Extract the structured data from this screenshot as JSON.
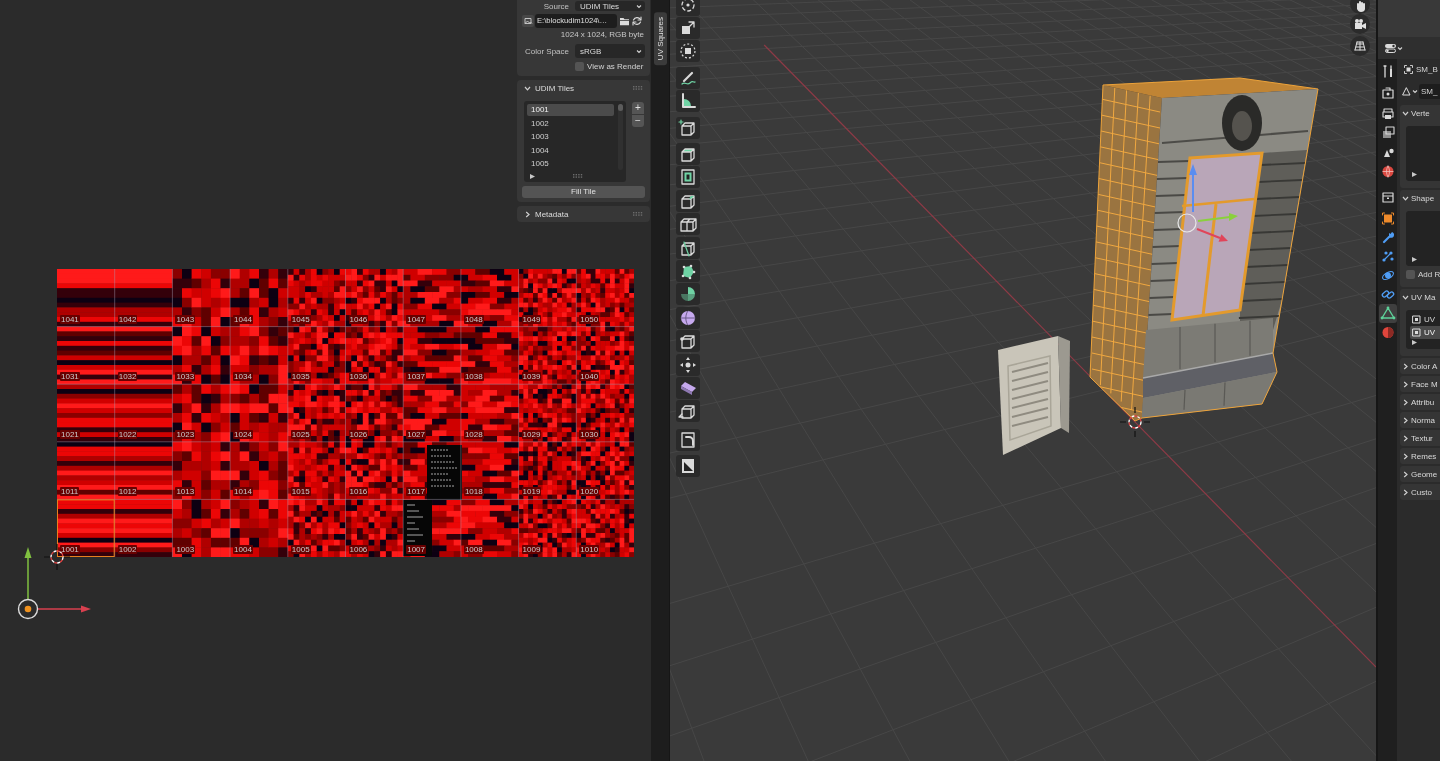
{
  "uv_editor": {
    "sidebar_tabs": [
      {
        "label": "UV Squares",
        "selected": true
      }
    ],
    "image_panel": {
      "source_label": "Source",
      "source_value": "UDIM Tiles",
      "filepath": "E:\\blockudim1024\\…",
      "info": "1024 x 1024, RGB byte",
      "color_space_label": "Color Space",
      "color_space_value": "sRGB",
      "view_as_render": {
        "label": "View as Render",
        "checked": false
      }
    },
    "udim_tiles_panel": {
      "title": "UDIM Tiles",
      "expanded": true,
      "items": [
        {
          "label": "1001",
          "selected": true
        },
        {
          "label": "1002",
          "selected": false
        },
        {
          "label": "1003",
          "selected": false
        },
        {
          "label": "1004",
          "selected": false
        },
        {
          "label": "1005",
          "selected": false
        }
      ],
      "add_button": "+",
      "remove_button": "−",
      "fill_button": "Fill Tile"
    },
    "metadata_panel": {
      "title": "Metadata",
      "expanded": false
    },
    "image_tiles": [
      "1041",
      "1042",
      "1043",
      "1044",
      "1045",
      "1046",
      "1047",
      "1048",
      "1049",
      "1050",
      "1031",
      "1032",
      "1033",
      "1034",
      "1035",
      "1036",
      "1037",
      "1038",
      "1039",
      "1040",
      "1021",
      "1022",
      "1023",
      "1024",
      "1025",
      "1026",
      "1027",
      "1028",
      "1029",
      "1030",
      "1011",
      "1012",
      "1013",
      "1014",
      "1015",
      "1016",
      "1017",
      "1018",
      "1019",
      "1020",
      "1001",
      "1002",
      "1003",
      "1004",
      "1005",
      "1006",
      "1007",
      "1008",
      "1009",
      "1010"
    ]
  },
  "properties": {
    "tabs": [
      {
        "selected": false
      },
      {
        "selected": false
      },
      {
        "selected": false
      },
      {
        "selected": false
      },
      {
        "selected": false
      },
      {
        "selected": false
      },
      {
        "selected": false
      },
      {
        "selected": false
      },
      {
        "selected": false
      },
      {
        "selected": false
      },
      {
        "selected": false
      },
      {
        "selected": false
      },
      {
        "selected": true
      },
      {
        "selected": false
      }
    ],
    "object_name": "SM_B",
    "mesh_name": "SM_",
    "panels": [
      {
        "title": "Verte",
        "expanded": true
      },
      {
        "title": "Shape",
        "expanded": true,
        "checkbox": {
          "label": "Add R",
          "checked": false
        }
      },
      {
        "title": "UV Ma",
        "expanded": true,
        "items": [
          {
            "label": "UV",
            "selected": false
          },
          {
            "label": "UV",
            "selected": true
          }
        ]
      },
      {
        "title": "Color A",
        "expanded": false
      },
      {
        "title": "Face M",
        "expanded": false
      },
      {
        "title": "Attribu",
        "expanded": false
      },
      {
        "title": "Norma",
        "expanded": false
      },
      {
        "title": "Textur",
        "expanded": false
      },
      {
        "title": "Remes",
        "expanded": false
      },
      {
        "title": "Geome",
        "expanded": false
      },
      {
        "title": "Custo",
        "expanded": false
      }
    ]
  }
}
